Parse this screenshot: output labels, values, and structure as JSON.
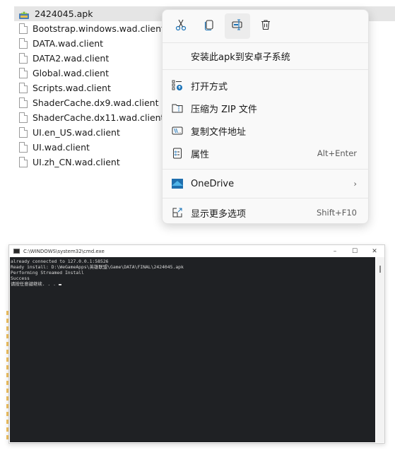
{
  "files": [
    {
      "name": "2424045.apk",
      "icon": "apk-icon",
      "selected": true
    },
    {
      "name": "Bootstrap.windows.wad.client",
      "icon": "file-icon"
    },
    {
      "name": "DATA.wad.client",
      "icon": "file-icon"
    },
    {
      "name": "DATA2.wad.client",
      "icon": "file-icon"
    },
    {
      "name": "Global.wad.client",
      "icon": "file-icon"
    },
    {
      "name": "Scripts.wad.client",
      "icon": "file-icon"
    },
    {
      "name": "ShaderCache.dx9.wad.client",
      "icon": "file-icon"
    },
    {
      "name": "ShaderCache.dx11.wad.client",
      "icon": "file-icon"
    },
    {
      "name": "UI.en_US.wad.client",
      "icon": "file-icon"
    },
    {
      "name": "UI.wad.client",
      "icon": "file-icon"
    },
    {
      "name": "UI.zh_CN.wad.client",
      "icon": "file-icon"
    }
  ],
  "context_menu": {
    "toolbar": [
      {
        "icon": "cut-icon",
        "label": "剪切"
      },
      {
        "icon": "copy-icon",
        "label": "复制"
      },
      {
        "icon": "rename-icon",
        "label": "重命名"
      },
      {
        "icon": "delete-icon",
        "label": "删除"
      }
    ],
    "install_label": "安装此apk到安卓子系统",
    "items": [
      {
        "icon": "open-with-icon",
        "label": "打开方式",
        "shortcut": ""
      },
      {
        "icon": "zip-folder-icon",
        "label": "压缩为 ZIP 文件",
        "shortcut": ""
      },
      {
        "icon": "copy-path-icon",
        "label": "复制文件地址",
        "shortcut": ""
      },
      {
        "icon": "properties-icon",
        "label": "属性",
        "shortcut": "Alt+Enter"
      }
    ],
    "onedrive_label": "OneDrive",
    "more_options_label": "显示更多选项",
    "more_options_shortcut": "Shift+F10"
  },
  "cmd": {
    "title": "C:\\WINDOWS\\system32\\cmd.exe",
    "lines": [
      "already connected to 127.0.0.1:58526",
      "Ready install: D:\\WeGameApps\\英雄联盟\\Game\\DATA\\FINAL\\2424045.apk",
      "Performing Streamed Install",
      "Success",
      "请按任意键继续. . . "
    ],
    "minimize": "–",
    "maximize": "☐",
    "close": "✕"
  },
  "colors": {
    "accent": "#1a73b8",
    "console_bg": "#1f2124",
    "menu_bg": "#f9f9f9"
  }
}
